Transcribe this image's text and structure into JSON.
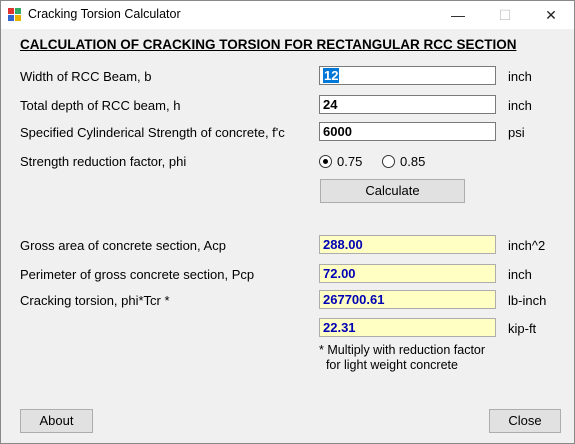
{
  "window": {
    "title": "Cracking Torsion Calculator",
    "minimize": "—",
    "maximize": "☐",
    "close": "✕"
  },
  "heading": "CALCULATION OF CRACKING TORSION FOR RECTANGULAR RCC SECTION",
  "inputs": {
    "width": {
      "label": "Width of RCC Beam, b",
      "value": "12",
      "unit": "inch"
    },
    "depth": {
      "label": "Total depth of RCC beam, h",
      "value": "24",
      "unit": "inch"
    },
    "fc": {
      "label": "Specified Cylinderical Strength of concrete, f'c",
      "value": "6000",
      "unit": "psi"
    }
  },
  "phi": {
    "label": "Strength reduction factor, phi",
    "options": [
      "0.75",
      "0.85"
    ],
    "selected": "0.75"
  },
  "calculate_label": "Calculate",
  "outputs": {
    "acp": {
      "label": "Gross area of concrete section, Acp",
      "value": "288.00",
      "unit": "inch^2"
    },
    "pcp": {
      "label": "Perimeter of gross concrete section, Pcp",
      "value": "72.00",
      "unit": "inch"
    },
    "tcr": {
      "label": "Cracking torsion, phi*Tcr *",
      "value": "267700.61",
      "unit": "lb-inch"
    },
    "tcr_kip": {
      "value": "22.31",
      "unit": "kip-ft"
    }
  },
  "note": "* Multiply with reduction factor\n  for light weight concrete",
  "about_label": "About",
  "close_label": "Close"
}
